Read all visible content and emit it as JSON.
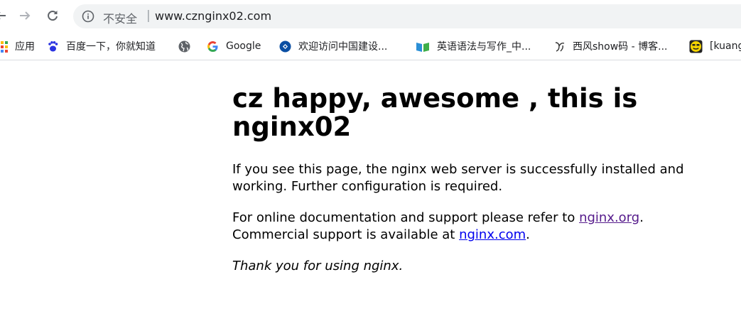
{
  "browser": {
    "insecure_label": "不安全",
    "separator": "|",
    "url": "www.cznginx02.com"
  },
  "bookmarks": [
    {
      "label": "应用",
      "icon": "apps-grid-icon"
    },
    {
      "label": "百度一下，你就知道",
      "icon": "baidu-paw-icon"
    },
    {
      "label": "",
      "icon": "globe-icon"
    },
    {
      "label": "Google",
      "icon": "google-g-icon"
    },
    {
      "label": "欢迎访问中国建设...",
      "icon": "ccb-logo-icon"
    },
    {
      "label": "英语语法与写作_中...",
      "icon": "book-icon"
    },
    {
      "label": "西风show码 - 博客...",
      "icon": "blog-logo-icon"
    },
    {
      "label": "[kuang",
      "icon": "smiley-face-icon"
    }
  ],
  "page": {
    "heading": "cz happy, awesome , this is nginx02",
    "para1": "If you see this page, the nginx web server is successfully installed and working. Further configuration is required.",
    "para2_prefix": "For online documentation and support please refer to ",
    "link_org": "nginx.org",
    "para2_mid": ".",
    "para2_line2": "Commercial support is available at ",
    "link_com": "nginx.com",
    "para2_end": ".",
    "para3": "Thank you for using nginx."
  },
  "colors": {
    "visited_link": "#551a8b",
    "link": "#0000ee",
    "omnibox_bg": "#f1f3f4"
  }
}
